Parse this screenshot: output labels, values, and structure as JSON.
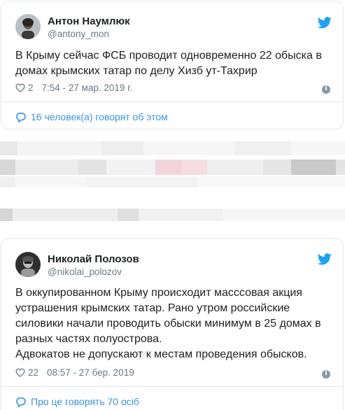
{
  "tweet1": {
    "name": "Антон Наумлюк",
    "handle": "@antony_mon",
    "text": "В Крыму сейчас ФСБ проводит одновременно 22 обыска в домах крымских татар по делу Хизб ут-Тахрир",
    "likes": "2",
    "time": "7:54 - 27 мар. 2019 г.",
    "action_label": "16 человек(а) говорят об этом"
  },
  "tweet2": {
    "name": "Николай Полозов",
    "handle": "@nikolai_polozov",
    "text_lines": [
      "В оккупированном Крыму происходит масссовая акция",
      "устрашения крымских татар. Рано утром российские",
      "силовики начали проводить обыски минимум в 25 домах в",
      "разных частях полуострова.",
      "Адвокатов не допускают к местам проведения обысков."
    ],
    "likes": "22",
    "time": "08:57 - 27 бер. 2019",
    "action_label": "Про це говорять 70 осіб"
  },
  "colors": {
    "twitter_blue": "#1da1f2",
    "link_blue": "#3b94d9",
    "muted": "#697882",
    "border": "#e1e8ed"
  },
  "icons": [
    "twitter-bird-icon",
    "heart-icon",
    "info-icon",
    "comment-icon"
  ]
}
